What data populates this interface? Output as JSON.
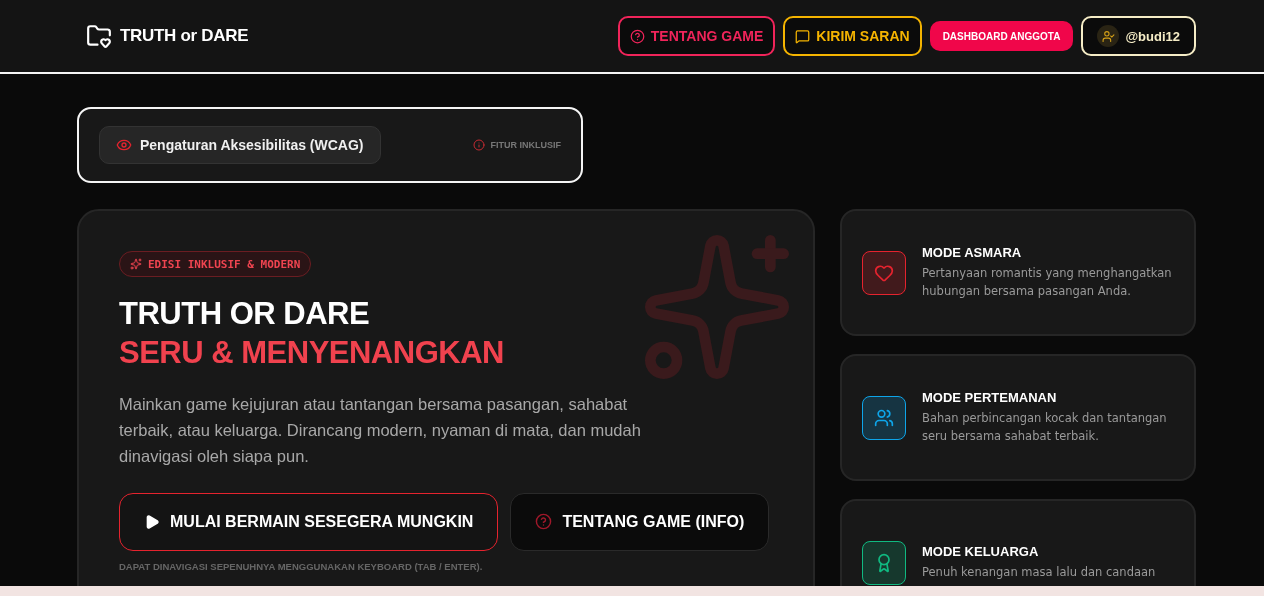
{
  "header": {
    "logo": "TRUTH or DARE",
    "nav": [
      {
        "kind": "outline-red",
        "label": "TENTANG GAME"
      },
      {
        "kind": "outline-yellow",
        "label": "KIRIM SARAN"
      },
      {
        "kind": "solid",
        "label": "DASHBOARD ANGGOTA"
      },
      {
        "kind": "user",
        "label": "@budi12"
      }
    ]
  },
  "accessibility": {
    "button": "Pengaturan Aksesibilitas (WCAG)",
    "note": "FITUR INKLUSIF"
  },
  "hero": {
    "badge": "EDISI INKLUSIF & MODERN",
    "title": "TRUTH OR DARE",
    "subtitle": "SERU & MENYENANGKAN",
    "description": "Mainkan game kejujuran atau tantangan bersama pasangan, sahabat terbaik, atau keluarga. Dirancang modern, nyaman di mata, dan mudah dinavigasi oleh siapa pun.",
    "buttons": [
      {
        "kind": "primary",
        "label": "MULAI BERMAIN SESEGERA MUNGKIN"
      },
      {
        "kind": "secondary",
        "label": "TENTANG GAME (INFO)"
      }
    ],
    "hint": "DAPAT DINAVIGASI SEPENUHNYA MENGGUNAKAN KEYBOARD (TAB / ENTER)."
  },
  "modes": [
    {
      "kind": "heart",
      "title": "MODE ASMARA",
      "description": "Pertanyaan romantis yang menghangatkan hubungan bersama pasangan Anda.",
      "color": "#e5232e"
    },
    {
      "kind": "users",
      "title": "MODE PERTEMANAN",
      "description": "Bahan perbincangan kocak dan tantangan seru bersama sahabat terbaik.",
      "color": "#0ea5e9"
    },
    {
      "kind": "award",
      "title": "MODE KELUARGA",
      "description": "Penuh kenangan masa lalu dan candaan",
      "color": "#10b981"
    }
  ]
}
